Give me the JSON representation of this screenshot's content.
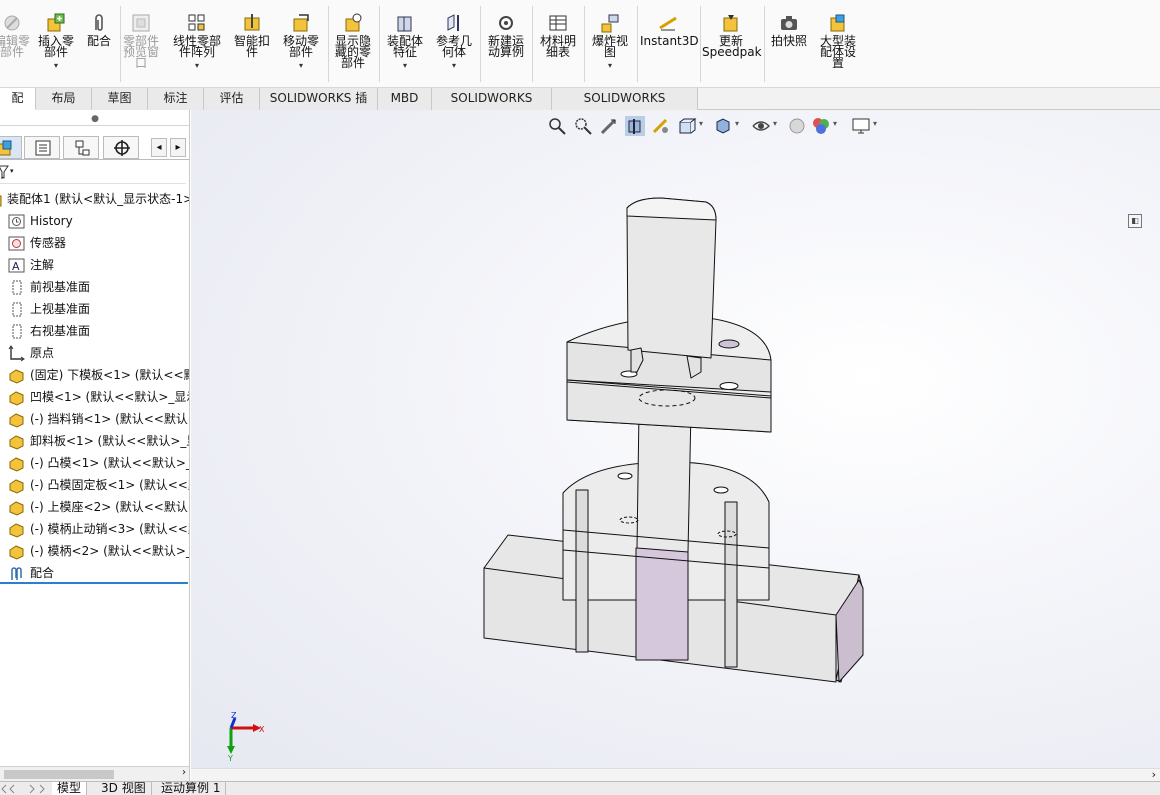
{
  "ribbon": {
    "buttons": [
      {
        "id": "edit-component",
        "label": "编辑零\n部件",
        "icon": "edit-component-icon",
        "disabled": true,
        "dropdown": false
      },
      {
        "id": "insert-component",
        "label": "插入零\n部件",
        "icon": "insert-component-icon",
        "disabled": false,
        "dropdown": true
      },
      {
        "id": "mate",
        "label": "配合",
        "icon": "mate-paperclip-icon",
        "disabled": false,
        "dropdown": false
      },
      {
        "id": "component-preview",
        "label": "零部件\n预览窗\n口",
        "icon": "preview-window-icon",
        "disabled": true,
        "dropdown": false
      },
      {
        "id": "linear-pattern",
        "label": "线性零部\n件阵列",
        "icon": "linear-pattern-icon",
        "disabled": false,
        "dropdown": true
      },
      {
        "id": "smart-fasteners",
        "label": "智能扣\n件",
        "icon": "smart-fastener-icon",
        "disabled": false,
        "dropdown": false
      },
      {
        "id": "move-component",
        "label": "移动零\n部件",
        "icon": "move-component-icon",
        "disabled": false,
        "dropdown": true
      },
      {
        "id": "show-hidden",
        "label": "显示隐\n藏的零\n部件",
        "icon": "show-hidden-icon",
        "disabled": false,
        "dropdown": false
      },
      {
        "id": "assembly-feature",
        "label": "装配体\n特征",
        "icon": "assembly-feature-icon",
        "disabled": false,
        "dropdown": true
      },
      {
        "id": "reference-geometry",
        "label": "参考几\n何体",
        "icon": "reference-geometry-icon",
        "disabled": false,
        "dropdown": true
      },
      {
        "id": "new-motion-study",
        "label": "新建运\n动算例",
        "icon": "motion-study-icon",
        "disabled": false,
        "dropdown": false
      },
      {
        "id": "bom",
        "label": "材料明\n细表",
        "icon": "bom-table-icon",
        "disabled": false,
        "dropdown": false
      },
      {
        "id": "exploded-view",
        "label": "爆炸视\n图",
        "icon": "exploded-view-icon",
        "disabled": false,
        "dropdown": true
      },
      {
        "id": "instant3d",
        "label": "Instant3D",
        "icon": "instant3d-icon",
        "disabled": false,
        "dropdown": false
      },
      {
        "id": "speedpak",
        "label": "更新\nSpeedpak",
        "icon": "speedpak-icon",
        "disabled": false,
        "dropdown": false
      },
      {
        "id": "snapshot",
        "label": "拍快照",
        "icon": "camera-icon",
        "disabled": false,
        "dropdown": false
      },
      {
        "id": "large-assembly",
        "label": "大型装\n配体设\n置",
        "icon": "large-assembly-icon",
        "disabled": false,
        "dropdown": false
      }
    ]
  },
  "command_tabs": [
    "配体",
    "布局",
    "草图",
    "标注",
    "评估",
    "SOLIDWORKS 插件",
    "MBD",
    "SOLIDWORKS CAM",
    "SOLIDWORKS Inspection"
  ],
  "command_tab_active": 0,
  "feature_tree": {
    "root": "装配体1  (默认<默认_显示状态-1>",
    "items": [
      {
        "label": "History",
        "icon": "history-icon"
      },
      {
        "label": "传感器",
        "icon": "sensor-icon"
      },
      {
        "label": "注解",
        "icon": "annotation-icon"
      },
      {
        "label": "前视基准面",
        "icon": "plane-icon"
      },
      {
        "label": "上视基准面",
        "icon": "plane-icon"
      },
      {
        "label": "右视基准面",
        "icon": "plane-icon"
      },
      {
        "label": "原点",
        "icon": "origin-icon"
      },
      {
        "label": "(固定) 下模板<1> (默认<<默",
        "icon": "part-icon"
      },
      {
        "label": "凹模<1> (默认<<默认>_显示",
        "icon": "part-icon"
      },
      {
        "label": "(-) 挡料销<1> (默认<<默认>",
        "icon": "part-icon"
      },
      {
        "label": "卸料板<1> (默认<<默认>_显",
        "icon": "part-icon"
      },
      {
        "label": "(-) 凸模<1> (默认<<默认>_显",
        "icon": "part-icon"
      },
      {
        "label": "(-) 凸模固定板<1> (默认<<默",
        "icon": "part-icon"
      },
      {
        "label": "(-) 上模座<2> (默认<<默认>",
        "icon": "part-icon"
      },
      {
        "label": "(-) 模柄止动销<3> (默认<<默",
        "icon": "part-icon"
      },
      {
        "label": "(-) 模柄<2> (默认<<默认>_显",
        "icon": "part-icon"
      },
      {
        "label": "配合",
        "icon": "mates-folder-icon"
      }
    ]
  },
  "triad": {
    "x": "X",
    "y": "Y",
    "z": "Z"
  },
  "bottom_tabs": [
    "模型",
    "3D 视图",
    "运动算例 1"
  ],
  "bottom_tab_active": 0,
  "colors": {
    "accent": "#2a7fd0",
    "part_icon": "#e8b400",
    "axis_x": "#d01010",
    "axis_y": "#10a010",
    "axis_z": "#1030d0"
  }
}
